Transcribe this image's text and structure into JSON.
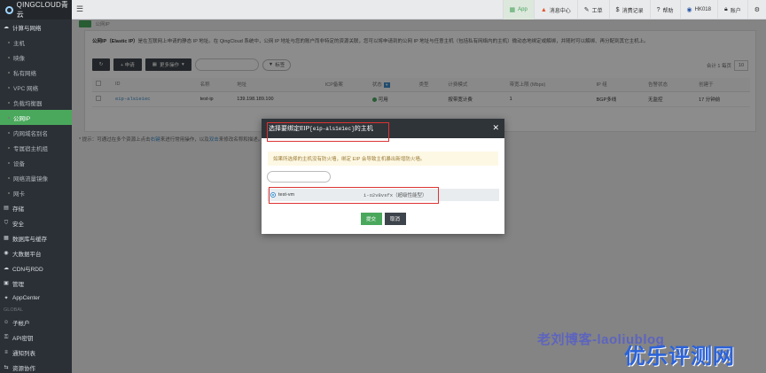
{
  "brand": "QINGCLOUD青云",
  "sidebar": {
    "group_compute": "计算与网络",
    "items": [
      "主机",
      "映像",
      "私有网络",
      "VPC 网络",
      "负载均衡器",
      "公网IP",
      "内网域名别名",
      "专属宿主机组",
      "设备",
      "网络流量镜像",
      "网卡"
    ],
    "active_index": 5,
    "groups": [
      "存储",
      "安全",
      "数据库与缓存",
      "大数据平台",
      "CDN与RDD",
      "管理",
      "AppCenter"
    ],
    "section_global": "GLOBAL",
    "global_items": [
      "子帐户",
      "API密钥",
      "通知列表",
      "资源协作"
    ]
  },
  "topbar": {
    "app": "App",
    "items": [
      "消息中心",
      "工单",
      "消费记录",
      "帮助",
      "账户",
      "设置"
    ],
    "region": "HK018",
    "account_label": "账户"
  },
  "breadcrumb": {
    "home": "",
    "current": "公网IP"
  },
  "description": {
    "bold": "公网IP（Elastic IP）",
    "text": "是在互联网上申请的静态 IP 地址。在 QingCloud 系统中，公网 IP 地址与您的账户而非特定的资源关联，您可以将申请到的公网 IP 地址与任意主机（包括私有网络内的主机）微动态地绑定或解绑，并随时可以解绑、再分配到其它主机上。"
  },
  "toolbar": {
    "refresh": "↻",
    "apply": "+ 申请",
    "more": "更多操作",
    "tag": "标签"
  },
  "pager": {
    "text": "合计 1 每页",
    "size": "10"
  },
  "table": {
    "headers": [
      "",
      "ID",
      "名称",
      "地址",
      "ICP备案",
      "状态",
      "类型",
      "计费模式",
      "带宽上限 (Mbps)",
      "IP 组",
      "告警状态",
      "创建于"
    ],
    "row": [
      "",
      "eip-als1e1ec",
      "test-ip",
      "139.198.189.100",
      "",
      "可用",
      "",
      "按带宽计费",
      "1",
      "BGP多线",
      "无监控",
      "17 分钟前"
    ]
  },
  "hint": {
    "prefix": "* 提示：可通过在多个资源上点击",
    "hl1": "右键",
    "mid": "来进行常用操作，以及",
    "hl2": "双击",
    "suffix": "来修改名称和描述。"
  },
  "modal": {
    "title_prefix": "选择要绑定EIP",
    "title_id": "[eip-als1e1ec]",
    "title_suffix": "的主机",
    "notice": "如果所选择的主机没有防火墙，绑定 EIP 会导致主机暴出新增防火墙。",
    "vm_name": "test-vm",
    "vm_id": "i-o2v8vsfx（超级性能型）",
    "submit": "提交",
    "cancel": "取消"
  },
  "watermarks": {
    "blog": "老刘博客-laoliublog",
    "site": "优乐评测网"
  }
}
